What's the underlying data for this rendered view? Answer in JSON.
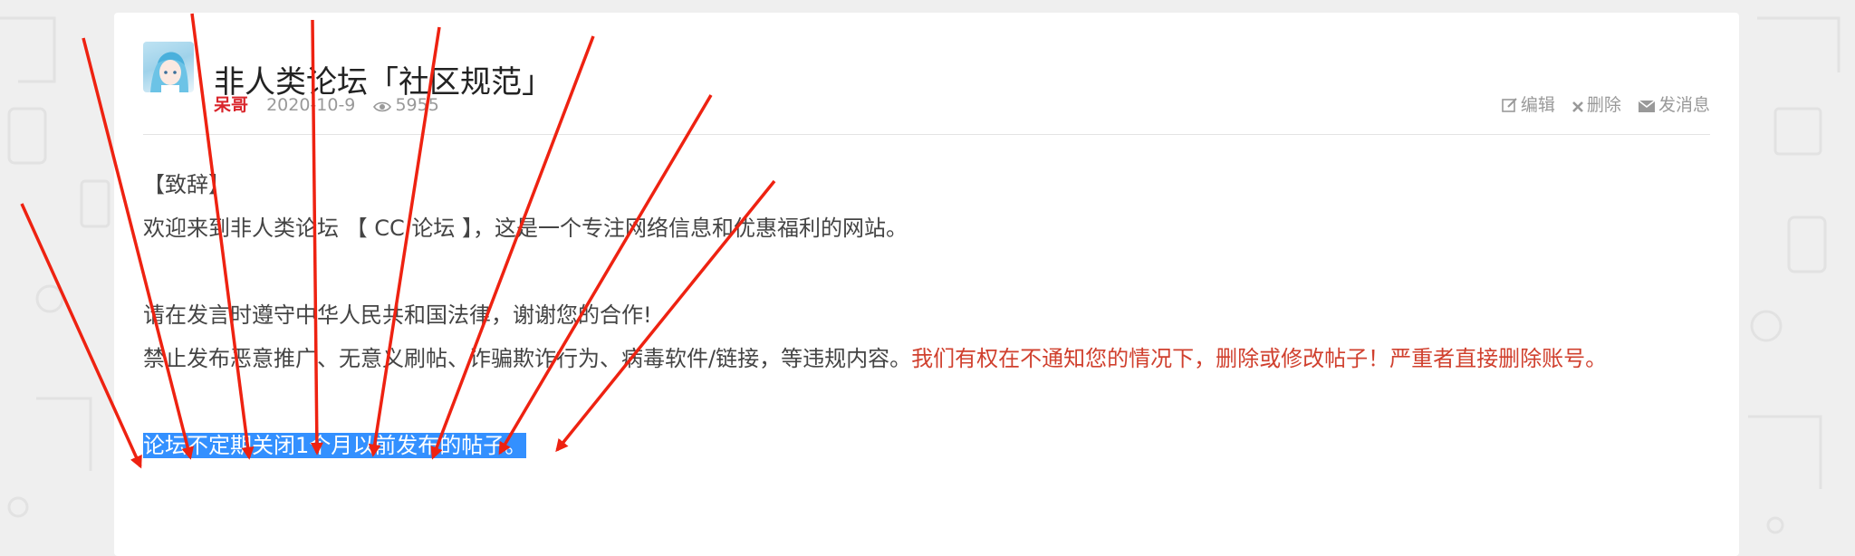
{
  "post": {
    "title": "非人类论坛「社区规范」",
    "author": "呆哥",
    "date": "2020-10-9",
    "views": "5955"
  },
  "actions": {
    "edit": "编辑",
    "delete": "删除",
    "message": "发消息"
  },
  "content": {
    "heading": "【致辞】",
    "welcome": "欢迎来到非人类论坛 【 CC 论坛 】，这是一个专注网络信息和优惠福利的网站。",
    "law": "请在发言时遵守中华人民共和国法律，谢谢您的合作!",
    "prohibit": "禁止发布恶意推广、无意义刷帖、诈骗欺诈行为、病毒软件/链接，等违规内容。",
    "warning": "我们有权在不通知您的情况下，删除或修改帖子！严重者直接删除账号。",
    "highlight": "论坛不定期关闭1个月以前发布的帖子。"
  },
  "colors": {
    "author": "#d9252b",
    "warning": "#d0402e",
    "selection": "#3390ff",
    "arrows": "#ee2211"
  }
}
